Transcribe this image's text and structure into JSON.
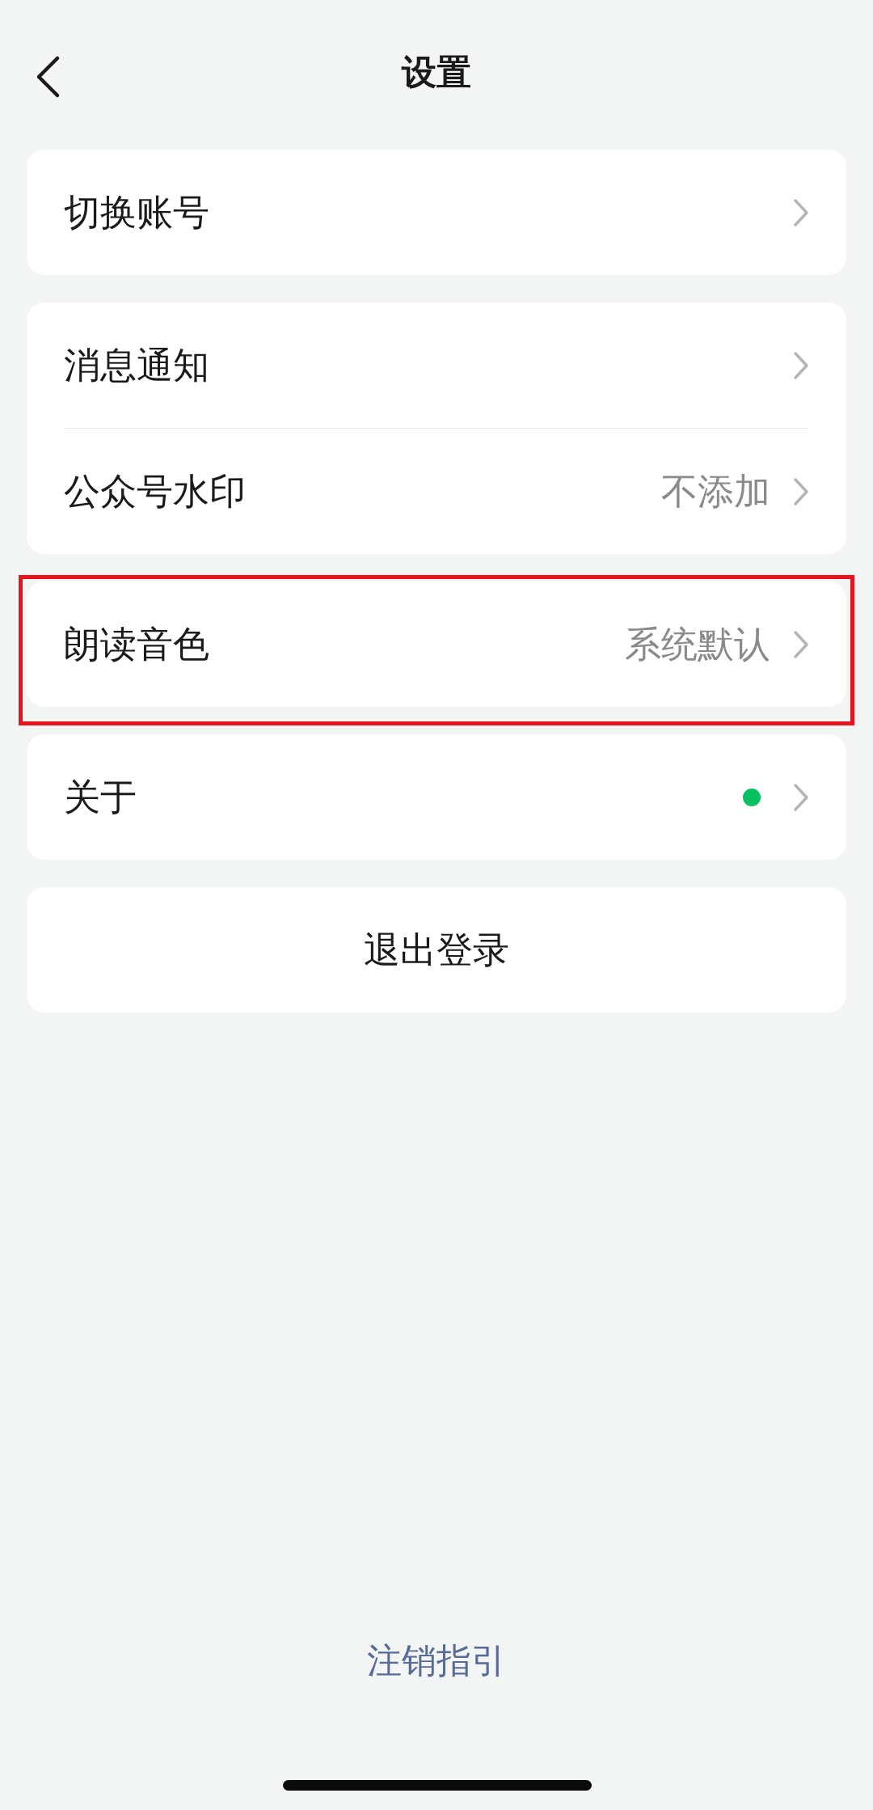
{
  "header": {
    "title": "设置"
  },
  "groups": [
    {
      "highlighted": false,
      "items": [
        {
          "label": "切换账号",
          "new_dot": false
        }
      ]
    },
    {
      "highlighted": false,
      "items": [
        {
          "label": "消息通知",
          "new_dot": false
        },
        {
          "label": "公众号水印",
          "value": "不添加",
          "new_dot": false
        }
      ]
    },
    {
      "highlighted": true,
      "items": [
        {
          "label": "朗读音色",
          "value": "系统默认",
          "new_dot": false
        }
      ]
    },
    {
      "highlighted": false,
      "items": [
        {
          "label": "关于",
          "new_dot": true
        }
      ]
    }
  ],
  "logout": {
    "label": "退出登录"
  },
  "footer_link": {
    "label": "注销指引"
  }
}
